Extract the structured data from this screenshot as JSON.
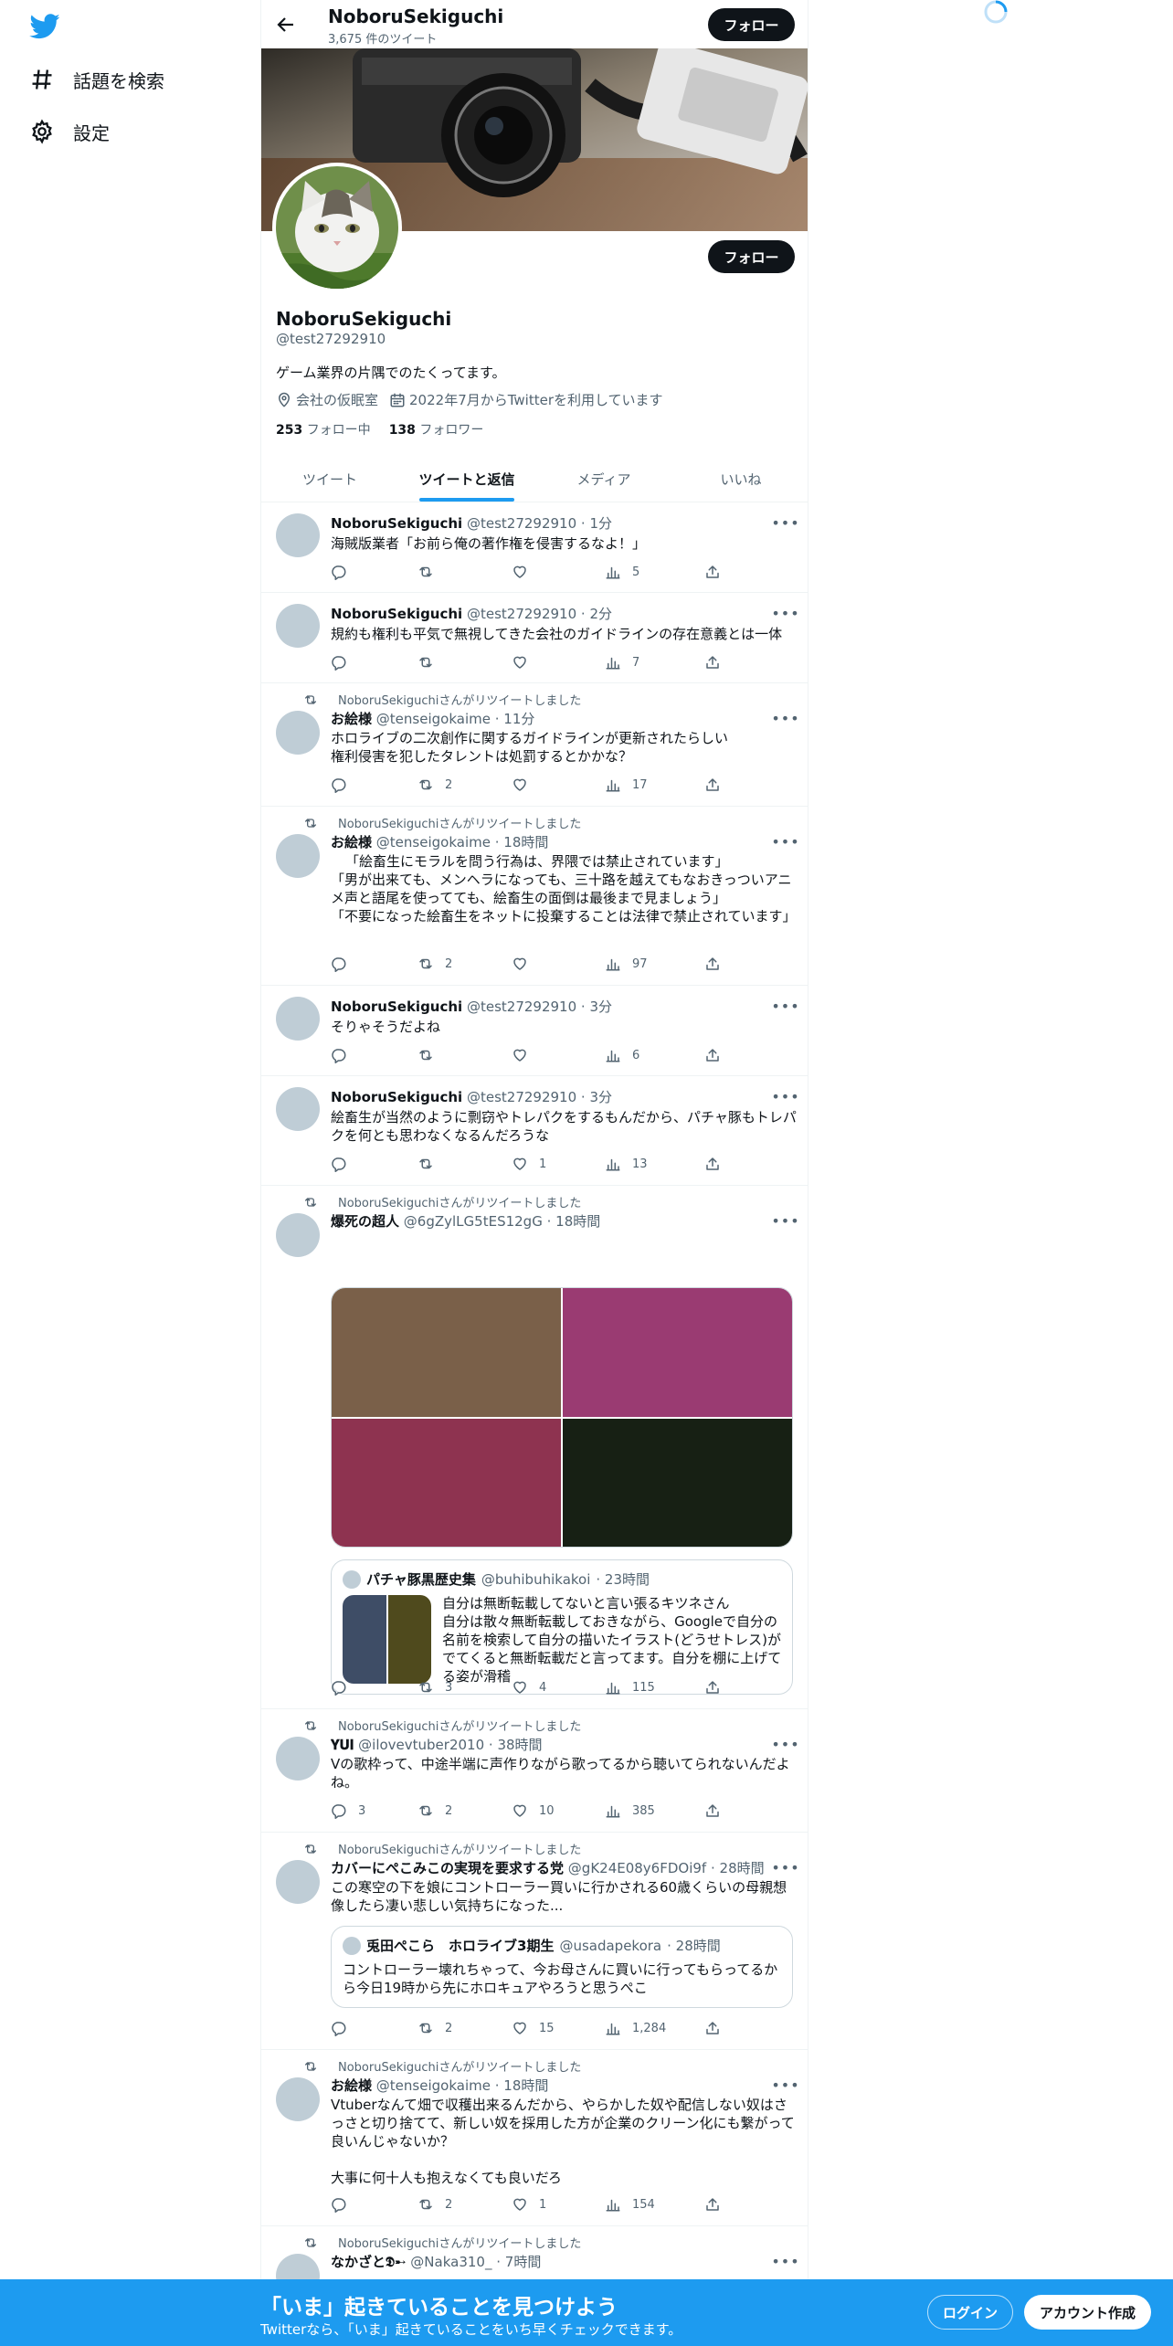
{
  "nav": {
    "explore": "話題を検索",
    "settings": "設定"
  },
  "header": {
    "name": "NoboruSekiguchi",
    "tweet_count": "3,675 件のツイート",
    "follow": "フォロー"
  },
  "profile": {
    "name": "NoboruSekiguchi",
    "handle": "@test27292910",
    "bio": "ゲーム業界の片隅でのたくってます。",
    "location": "会社の仮眠室",
    "joined": "2022年7月からTwitterを利用しています",
    "following_count": "253",
    "following_label": "フォロー中",
    "followers_count": "138",
    "followers_label": "フォロワー",
    "follow": "フォロー"
  },
  "tabs": [
    {
      "label": "ツイート"
    },
    {
      "label": "ツイートと返信"
    },
    {
      "label": "メディア"
    },
    {
      "label": "いいね"
    }
  ],
  "retweet_label": "NoboruSekiguchiさんがリツイートしました",
  "tweets": [
    {
      "name": "NoboruSekiguchi",
      "handle": "@test27292910",
      "time": "· 1分",
      "text": "海賊版業者「お前ら俺の著作権を侵害するなよ！」",
      "replies": "",
      "retweets": "",
      "likes": "",
      "views": "5"
    },
    {
      "name": "NoboruSekiguchi",
      "handle": "@test27292910",
      "time": "· 2分",
      "text": "規約も権利も平気で無視してきた会社のガイドラインの存在意義とは一体",
      "replies": "",
      "retweets": "",
      "likes": "",
      "views": "7"
    },
    {
      "name": "お絵様",
      "handle": "@tenseigokaime",
      "time": "· 11分",
      "text": "ホロライブの二次創作に関するガイドラインが更新されたらしい\n権利侵害を犯したタレントは処罰するとかかな？",
      "replies": "",
      "retweets": "2",
      "likes": "",
      "views": "17"
    },
    {
      "name": "お絵様",
      "handle": "@tenseigokaime",
      "time": "· 18時間",
      "text": "「絵畜生にモラルを問う行為は、界隈では禁止されています」\n「男が出来ても、メンヘラになっても、三十路を越えてもなおきっついアニメ声と語尾を使ってても、絵畜生の面倒は最後まで見ましょう」\n「不要になった絵畜生をネットに投棄することは法律で禁止されています」",
      "replies": "",
      "retweets": "2",
      "likes": "",
      "views": "97"
    },
    {
      "name": "NoboruSekiguchi",
      "handle": "@test27292910",
      "time": "· 3分",
      "text": "そりゃそうだよね",
      "replies": "",
      "retweets": "",
      "likes": "",
      "views": "6"
    },
    {
      "name": "NoboruSekiguchi",
      "handle": "@test27292910",
      "time": "· 3分",
      "text": "絵畜生が当然のように剽窃やトレパクをするもんだから、パチャ豚もトレパクを何とも思わなくなるんだろうな",
      "replies": "",
      "retweets": "",
      "likes": "1",
      "views": "13"
    },
    {
      "name": "爆死の超人",
      "handle": "@6gZylLG5tES12gG",
      "time": "· 18時間",
      "text": "",
      "replies": "",
      "retweets": "3",
      "likes": "4",
      "views": "115",
      "quote": {
        "name": "パチャ豚黒歴史集",
        "handle": "@buhibuhikakoi",
        "time": "· 23時間",
        "text": "自分は無断転載してないと言い張るキツネさん\n自分は散々無断転載しておきながら、Googleで自分の名前を検索して自分の描いたイラスト(どうせトレス)がでてくると無断転載だと言ってます。自分を棚に上げてる姿が滑稽"
      }
    },
    {
      "name": "𝐘𝐔𝐈",
      "handle": "@ilovevtuber2010",
      "time": "· 38時間",
      "text": "Vの歌枠って、中途半端に声作りながら歌ってるから聴いてられないんだよね。",
      "replies": "3",
      "retweets": "2",
      "likes": "10",
      "views": "385"
    },
    {
      "name": "カバーにぺこみこの実現を要求する党",
      "handle": "@gK24E08y6FDOi9f",
      "time": "· 28時間",
      "text": "この寒空の下を娘にコントローラー買いに行かされる60歳くらいの母親想像したら凄い悲しい気持ちになった...",
      "replies": "",
      "retweets": "2",
      "likes": "15",
      "views": "1,284",
      "quote": {
        "name": "兎田ぺこら　ホロライブ3期生",
        "handle": "@usadapekora",
        "time": "· 28時間",
        "text": "コントローラー壊れちゃって、今お母さんに買いに行ってもらってるから今日19時から先にホロキュアやろうと思うぺこ"
      }
    },
    {
      "name": "お絵様",
      "handle": "@tenseigokaime",
      "time": "· 18時間",
      "text": "Vtuberなんて畑で収穫出来るんだから、やらかした奴や配信しない奴はさっさと切り捨てて、新しい奴を採用した方が企業のクリーン化にも繋がって良いんじゃないか？\n\n大事に何十人も抱えなくても良いだろ",
      "replies": "",
      "retweets": "2",
      "likes": "1",
      "views": "154"
    },
    {
      "name": "なかざと𝕯➸",
      "handle": "@Naka310_",
      "time": "· 7時間",
      "text": "",
      "replies": "",
      "retweets": "",
      "likes": "",
      "views": ""
    }
  ],
  "media_colors": [
    "#7a6049",
    "#9a3b72",
    "#8e3350",
    "#172014"
  ],
  "quote_thumb_colors": [
    "#3e4d66",
    "#4f4a1d"
  ],
  "bottom_bar": {
    "title": "「いま」起きていることを見つけよう",
    "subtitle": "Twitterなら、「いま」起きていることをいち早くチェックできます。",
    "login": "ログイン",
    "signup": "アカウント作成"
  }
}
